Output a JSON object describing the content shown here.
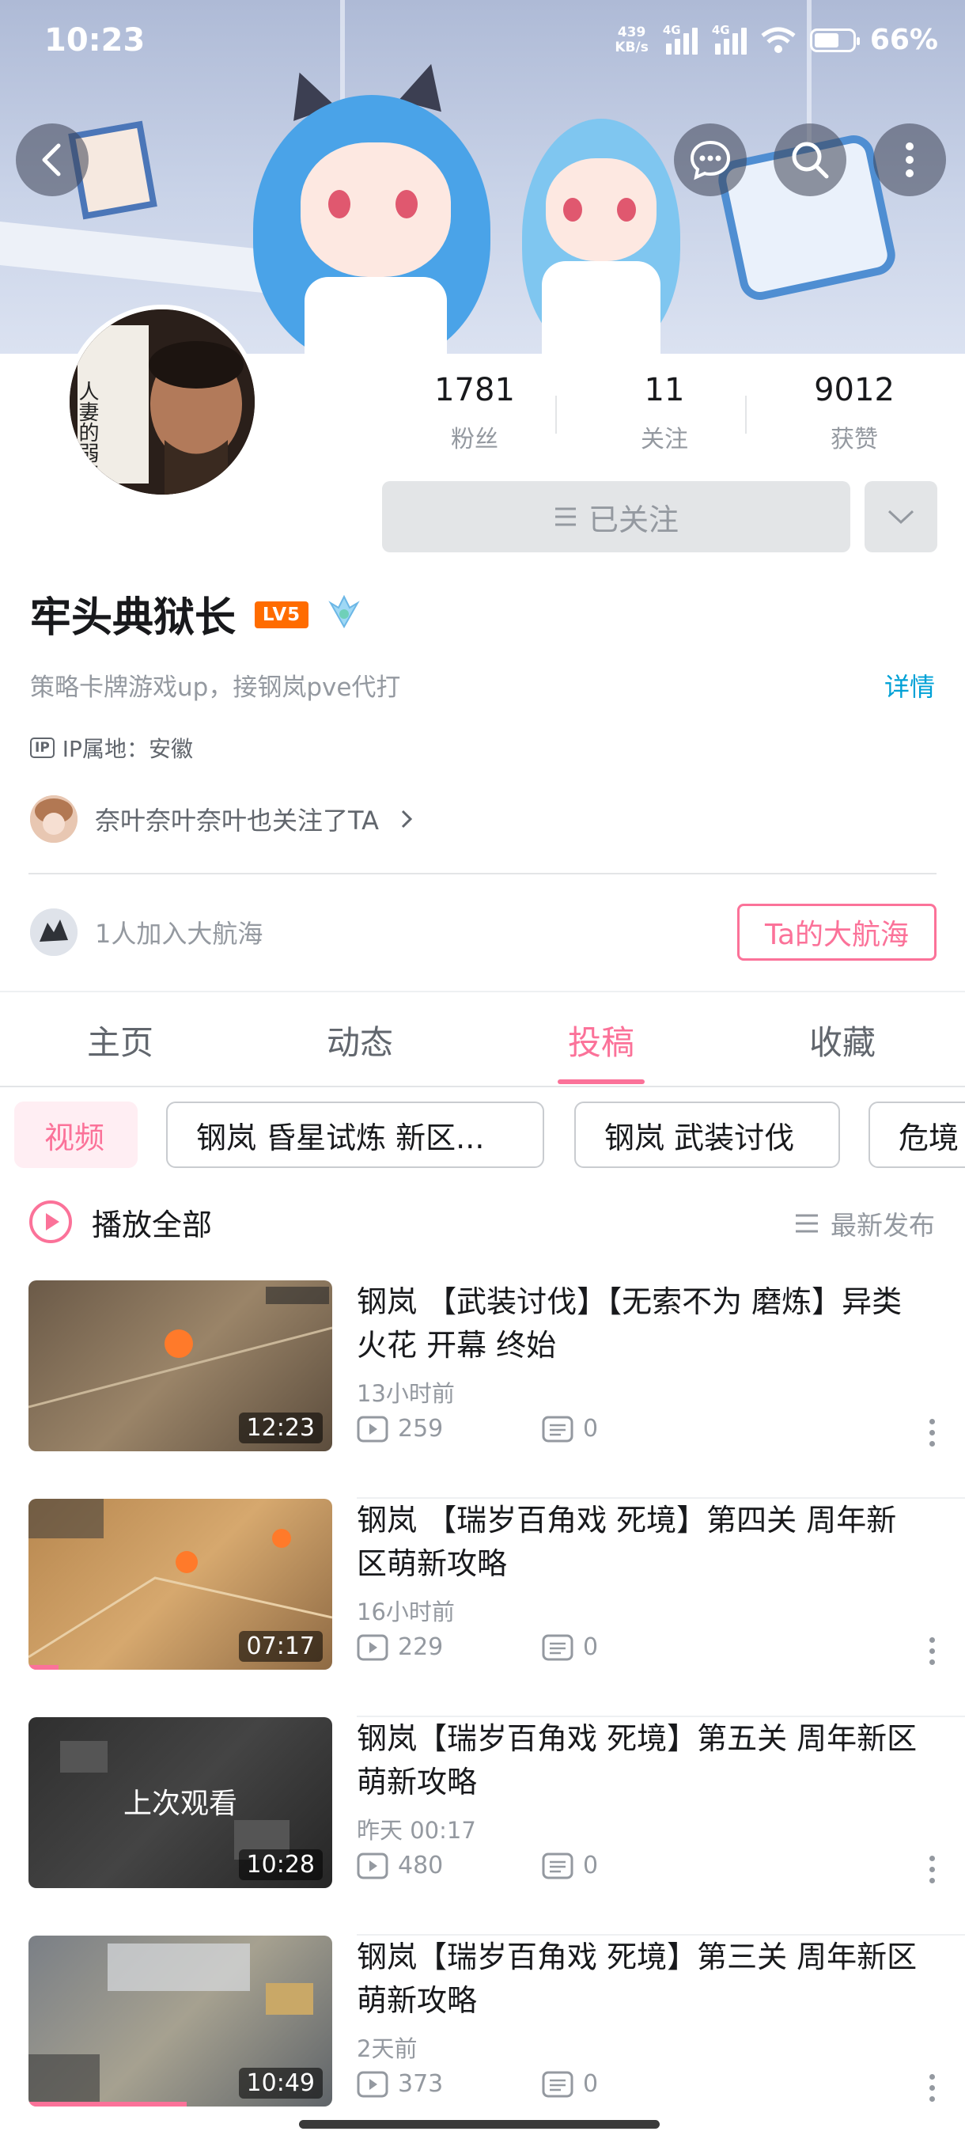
{
  "status_bar": {
    "time": "10:23",
    "net_speed_value": "439",
    "net_speed_unit": "KB/s",
    "signal1_label": "4G",
    "signal2_label": "4G",
    "battery_percent": "66%"
  },
  "header": {
    "back_icon": "chevron-left-icon",
    "message_icon": "message-icon",
    "search_icon": "search-icon",
    "more_icon": "more-vertical-icon"
  },
  "profile": {
    "name": "牢头典狱长",
    "level_badge": "LV5",
    "stats": [
      {
        "value": "1781",
        "label": "粉丝"
      },
      {
        "value": "11",
        "label": "关注"
      },
      {
        "value": "9012",
        "label": "获赞"
      }
    ],
    "follow_button_label": "已关注",
    "bio": "策略卡牌游戏up，接钢岚pve代打",
    "detail_link": "详情",
    "ip_tag": "IP",
    "ip_location": "IP属地：安徽",
    "mutual_follow_name": "奈叶奈叶奈叶",
    "mutual_follow_suffix": "也关注了TA",
    "fleet_text": "1人加入大航海",
    "fleet_button": "Ta的大航海",
    "avatar_book_text": "人妻的弱点"
  },
  "tabs": [
    "主页",
    "动态",
    "投稿",
    "收藏"
  ],
  "active_tab": "投稿",
  "chips": [
    "视频",
    "钢岚 昏星试炼 新区...",
    "钢岚 武装讨伐",
    "危境"
  ],
  "list_header": {
    "play_all": "播放全部",
    "sort": "最新发布"
  },
  "videos": [
    {
      "title": "钢岚 【武装讨伐】【无索不为 磨炼】异类 火花 开幕 终始",
      "time": "13小时前",
      "plays": "259",
      "comments": "0",
      "duration": "12:23",
      "overlay": "",
      "progress": 0
    },
    {
      "title": "钢岚 【瑞岁百角戏 死境】第四关 周年新区萌新攻略",
      "time": "16小时前",
      "plays": "229",
      "comments": "0",
      "duration": "07:17",
      "overlay": "",
      "progress": 0.1
    },
    {
      "title": "钢岚【瑞岁百角戏 死境】第五关 周年新区萌新攻略",
      "time": "昨天 00:17",
      "plays": "480",
      "comments": "0",
      "duration": "10:28",
      "overlay": "上次观看",
      "progress": 0
    },
    {
      "title": "钢岚【瑞岁百角戏 死境】第三关 周年新区萌新攻略",
      "time": "2天前",
      "plays": "373",
      "comments": "0",
      "duration": "10:49",
      "overlay": "",
      "progress": 0.52
    }
  ],
  "colors": {
    "accent_pink": "#fb7299",
    "link_blue": "#00a1d6",
    "level_orange": "#ff6c00"
  }
}
